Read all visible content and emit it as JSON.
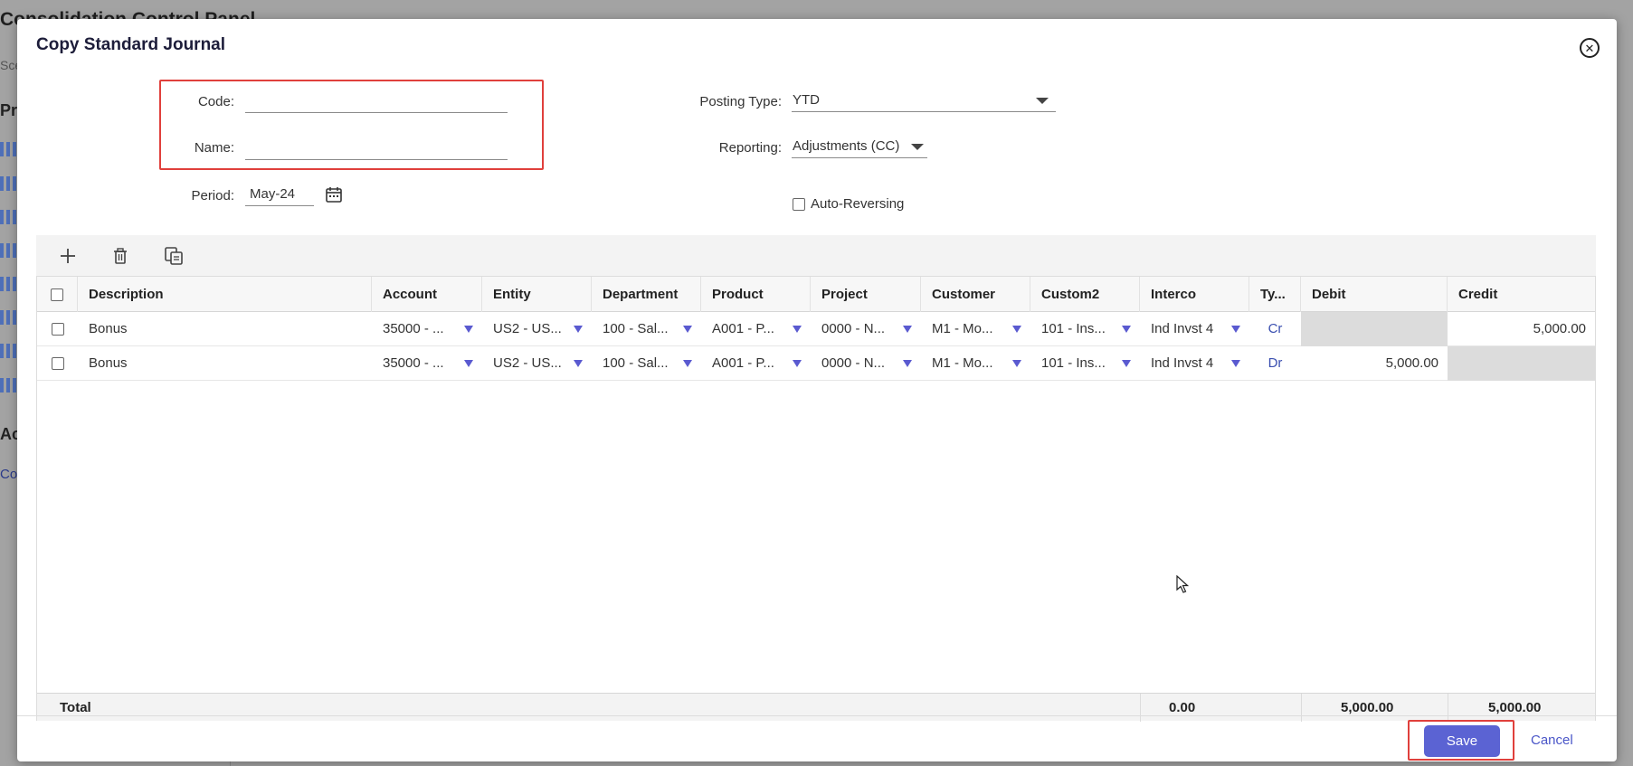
{
  "dialog": {
    "title": "Copy Standard Journal",
    "close_icon": "close-circle-icon"
  },
  "form": {
    "code_label": "Code:",
    "code_value": "",
    "name_label": "Name:",
    "name_value": "",
    "period_label": "Period:",
    "period_value": "May-24",
    "calendar_icon": "calendar-icon",
    "posting_type_label": "Posting Type:",
    "posting_type_value": "YTD",
    "reporting_label": "Reporting:",
    "reporting_value": "Adjustments (CC)",
    "auto_reversing_label": "Auto-Reversing",
    "auto_reversing_checked": false
  },
  "toolbar": {
    "add_icon": "plus-icon",
    "delete_icon": "trash-icon",
    "copy_icon": "copy-icon"
  },
  "grid": {
    "columns": [
      "Description",
      "Account",
      "Entity",
      "Department",
      "Product",
      "Project",
      "Customer",
      "Custom2",
      "Interco",
      "Ty...",
      "Debit",
      "Credit"
    ],
    "rows": [
      {
        "description": "Bonus",
        "account": "35000 - ...",
        "entity": "US2 - US...",
        "department": "100 - Sal...",
        "product": "A001 - P...",
        "project": "0000 - N...",
        "customer": "M1 - Mo...",
        "custom2": "101 - Ins...",
        "interco": "Ind Invst 4",
        "type": "Cr",
        "debit": "",
        "credit": "5,000.00"
      },
      {
        "description": "Bonus",
        "account": "35000 - ...",
        "entity": "US2 - US...",
        "department": "100 - Sal...",
        "product": "A001 - P...",
        "project": "0000 - N...",
        "customer": "M1 - Mo...",
        "custom2": "101 - Ins...",
        "interco": "Ind Invst 4",
        "type": "Dr",
        "debit": "5,000.00",
        "credit": ""
      }
    ],
    "total": {
      "label": "Total",
      "difference": "0.00",
      "debit": "5,000.00",
      "credit": "5,000.00"
    }
  },
  "footer": {
    "save_label": "Save",
    "cancel_label": "Cancel"
  },
  "background": {
    "page_title": "Consolidation Control Panel",
    "tab_fragment": "Sce",
    "section_1": "Pr",
    "section_2": "Ac",
    "link_fragment": "Co"
  },
  "colors": {
    "accent": "#5b63d3",
    "highlight": "#e0403c",
    "type_link": "#3a4fb0",
    "dropdown_arrow": "#5a5ad0"
  }
}
